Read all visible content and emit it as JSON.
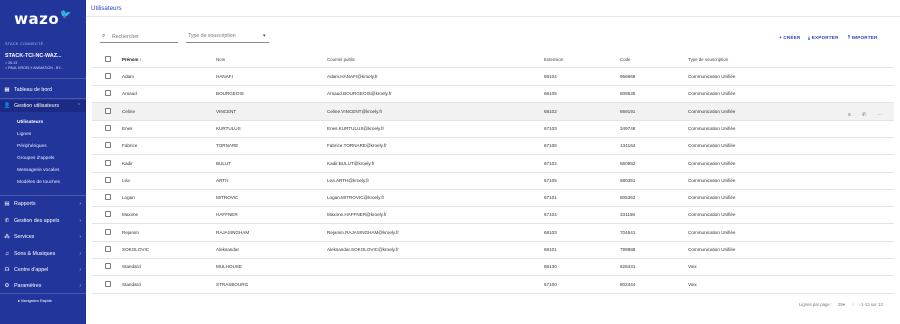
{
  "sidebar": {
    "logo": "wazo",
    "stack_caption": "STACK CONNECTÉ",
    "stack_name": "STACK-TCI-NC-WAZ...",
    "stack_version": "> 26.13",
    "stack_org": "> PAUL KROELY ANIMATION - BY...",
    "nav": [
      {
        "label": "Tableau de bord"
      },
      {
        "label": "Gestion utilisateurs"
      },
      {
        "label": "Rapports"
      },
      {
        "label": "Gestion des appels"
      },
      {
        "label": "Services"
      },
      {
        "label": "Sons & Musiques"
      },
      {
        "label": "Centre d'appel"
      },
      {
        "label": "Paramètres"
      }
    ],
    "subitems": [
      {
        "label": "Utilisateurs"
      },
      {
        "label": "Lignes"
      },
      {
        "label": "Périphériques"
      },
      {
        "label": "Groupes d'appels"
      },
      {
        "label": "Messagerie vocales"
      },
      {
        "label": "Modèles de touches"
      }
    ],
    "quick_nav": "Navigation Rapide"
  },
  "breadcrumb": "Utilisateurs",
  "search": {
    "placeholder": "Rechercher"
  },
  "filter": {
    "label": "Type de souscription"
  },
  "actions": {
    "create": "CRÉER",
    "export": "EXPORTER",
    "import": "IMPORTER"
  },
  "table": {
    "headers": {
      "firstname": "Prénom",
      "lastname": "Nom",
      "email": "Courriel public",
      "extension": "Extension",
      "code": "Code",
      "subscription": "Type de souscription"
    },
    "rows": [
      {
        "firstname": "Adam",
        "lastname": "HANAFI",
        "email": "Adam.HANAFI@kroely.fr",
        "extension": "68104",
        "code": "956868",
        "subscription": "Communication Unifiée"
      },
      {
        "firstname": "Arnaud",
        "lastname": "BOURGEOIS",
        "email": "Arnaud.BOURGEOIS@kroely.fr",
        "extension": "68105",
        "code": "808535",
        "subscription": "Communication Unifiée"
      },
      {
        "firstname": "Celine",
        "lastname": "VINCENT",
        "email": "Celine.VINCENT@kroely.fr",
        "extension": "68102",
        "code": "869191",
        "subscription": "Communication Unifiée"
      },
      {
        "firstname": "Enes",
        "lastname": "KURTULUS",
        "email": "Enes.KURTULUS@kroely.fr",
        "extension": "67103",
        "code": "349748",
        "subscription": "Communication Unifiée"
      },
      {
        "firstname": "Fabrice",
        "lastname": "TORNARE",
        "email": "Fabrice.TORNARE@kroely.fr",
        "extension": "67106",
        "code": "134164",
        "subscription": "Communication Unifiée"
      },
      {
        "firstname": "Kadir",
        "lastname": "BULUT",
        "email": "Kadir.BULUT@kroely.fr",
        "extension": "67102",
        "code": "560982",
        "subscription": "Communication Unifiée"
      },
      {
        "firstname": "Léa",
        "lastname": "ARTH",
        "email": "Lea.ARTH@kroely.fr",
        "extension": "67105",
        "code": "680351",
        "subscription": "Communication Unifiée"
      },
      {
        "firstname": "Logan",
        "lastname": "MITROVIC",
        "email": "Logan.MITROVIC@kroely.fr",
        "extension": "67101",
        "code": "805362",
        "subscription": "Communication Unifiée"
      },
      {
        "firstname": "Maxime",
        "lastname": "HAFFNER",
        "email": "Maxime.HAFFNER@kroely.fr",
        "extension": "67104",
        "code": "331158",
        "subscription": "Communication Unifiée"
      },
      {
        "firstname": "Rejanim",
        "lastname": "RAJASINGHAM",
        "email": "Rejanim.RAJASINGHAM@kroely.fr",
        "extension": "68103",
        "code": "704641",
        "subscription": "Communication Unifiée"
      },
      {
        "firstname": "SOKOLOVIC",
        "lastname": "Aleksandar",
        "email": "Aleksandar.SOKOLOVIC@kroely.fr",
        "extension": "68101",
        "code": "799888",
        "subscription": "Communication Unifiée"
      },
      {
        "firstname": "Standard",
        "lastname": "MULHOUSE",
        "email": "",
        "extension": "68130",
        "code": "626431",
        "subscription": "Voix"
      },
      {
        "firstname": "Standard",
        "lastname": "STRASBOURG",
        "email": "",
        "extension": "67100",
        "code": "802444",
        "subscription": "Voix"
      }
    ]
  },
  "pagination": {
    "rows_per_page_label": "Lignes par page :",
    "rows_per_page_value": "25",
    "range": "1-13 sur 13"
  },
  "colors": {
    "sidebar": "#22359b",
    "accent": "#2d45c0"
  }
}
